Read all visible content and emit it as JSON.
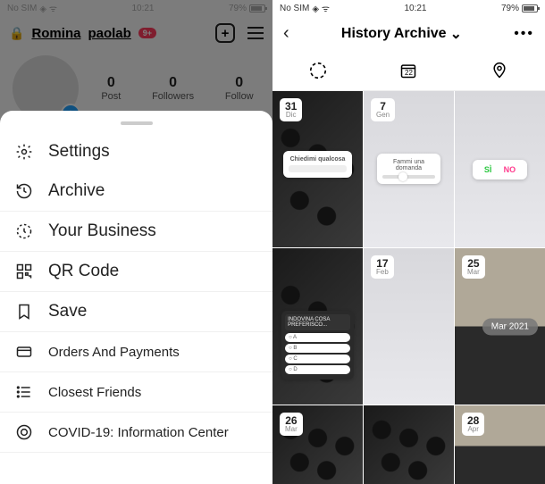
{
  "status": {
    "carrier": "No SIM",
    "time": "10:21",
    "battery": "79%"
  },
  "left": {
    "username": "Romina",
    "username2": "paolab",
    "notif": "9+",
    "stats": [
      {
        "n": "0",
        "l": "Post"
      },
      {
        "n": "0",
        "l": "Followers"
      },
      {
        "n": "0",
        "l": "Follow"
      }
    ],
    "menu": [
      {
        "icon": "gear",
        "label": "Settings",
        "big": true
      },
      {
        "icon": "history",
        "label": "Archive",
        "big": true
      },
      {
        "icon": "activity",
        "label": "Your Business",
        "big": true
      },
      {
        "icon": "qr",
        "label": "QR Code",
        "big": true
      },
      {
        "icon": "bookmark",
        "label": "Save",
        "big": true
      },
      {
        "icon": "card",
        "label": "Orders And Payments",
        "big": false
      },
      {
        "icon": "list",
        "label": "Closest Friends",
        "big": false
      },
      {
        "icon": "info",
        "label": "COVID-19: Information Center",
        "big": false
      }
    ]
  },
  "right": {
    "title": "History Archive",
    "tiles": [
      {
        "d": "31",
        "m": "Dic",
        "bg": "kb",
        "w": "ask",
        "wt": "Chiedimi qualcosa"
      },
      {
        "d": "7",
        "m": "Gen",
        "bg": "light",
        "w": "slider",
        "wt": "Fammi una domanda"
      },
      {
        "d": "",
        "m": "",
        "bg": "light",
        "w": "yn"
      },
      {
        "d": "",
        "m": "",
        "bg": "kb",
        "w": "poll",
        "wt": "INDOVINA COSA PREFERISCO..."
      },
      {
        "d": "17",
        "m": "feb",
        "bg": "light",
        "w": "none"
      },
      {
        "d": "25",
        "m": "mar",
        "bg": "desk",
        "w": "month",
        "wt": "Mar 2021"
      },
      {
        "d": "26",
        "m": "mar",
        "bg": "kb",
        "w": "none",
        "short": true
      },
      {
        "d": "",
        "m": "",
        "bg": "kb",
        "w": "none",
        "short": true
      },
      {
        "d": "28",
        "m": "apr",
        "bg": "desk",
        "w": "none",
        "short": true
      }
    ],
    "yn_yes": "SÌ",
    "yn_no": "NO",
    "cal_num": "22"
  }
}
